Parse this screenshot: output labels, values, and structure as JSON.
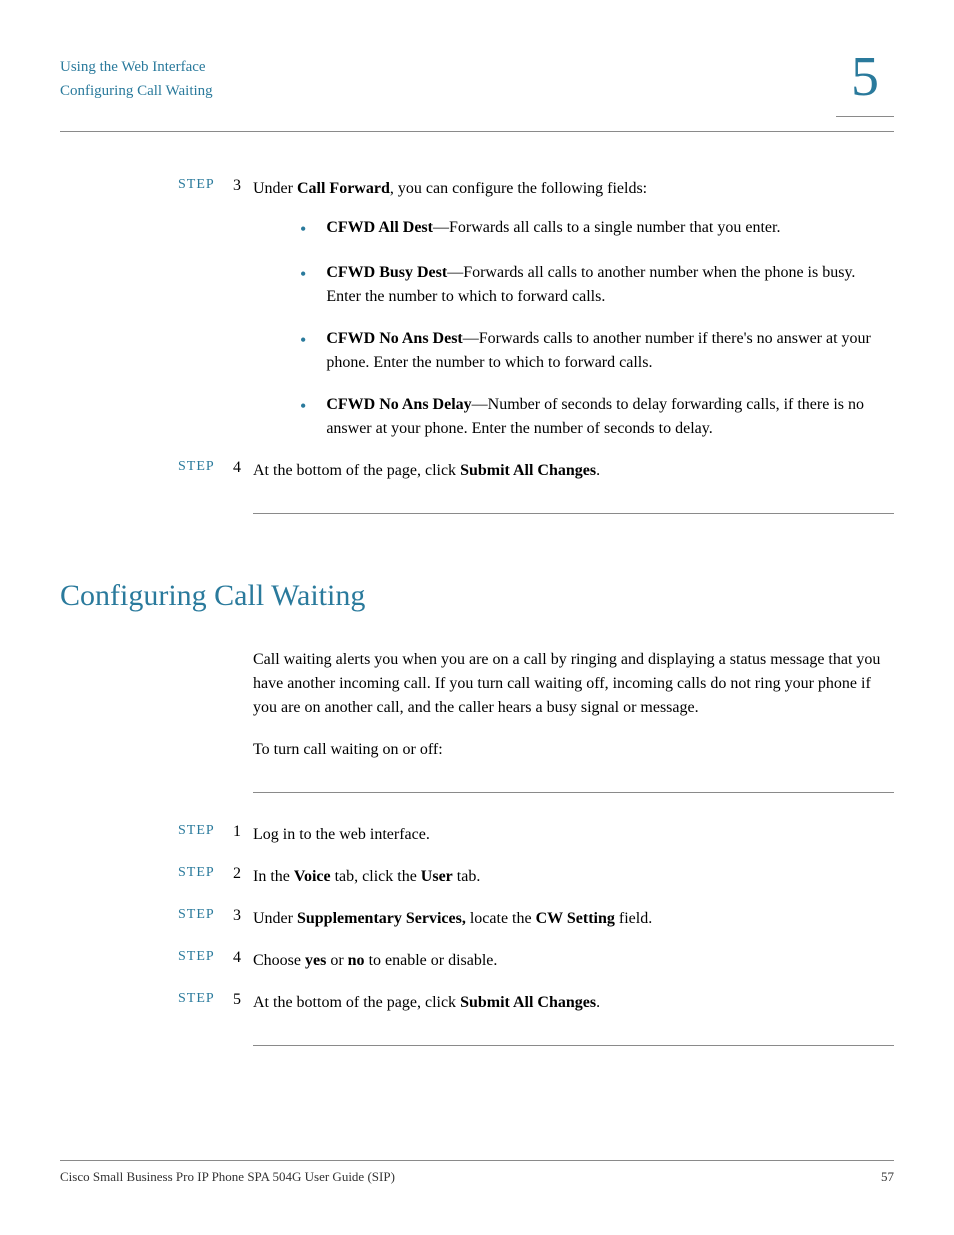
{
  "header": {
    "line1": "Using the Web Interface",
    "line2": "Configuring Call Waiting",
    "chapter": "5"
  },
  "top_steps": {
    "step3": {
      "label": "STEP",
      "num": "3",
      "intro_before_bold": "Under ",
      "intro_bold": "Call Forward",
      "intro_after_bold": ", you can configure the following fields:"
    },
    "bullets": [
      {
        "bold": "CFWD All Dest",
        "rest": "—Forwards all calls to a single number that you enter."
      },
      {
        "bold": "CFWD Busy Dest",
        "rest": "—Forwards all calls to another number when the phone is busy. Enter the number to which to forward calls."
      },
      {
        "bold": "CFWD No Ans Dest",
        "rest": "—Forwards calls to another number if there's no answer at your phone. Enter the number to which to forward calls."
      },
      {
        "bold": "CFWD No Ans Delay",
        "rest": "—Number of seconds to delay forwarding calls, if there is no answer at your phone. Enter the number of seconds to delay."
      }
    ],
    "step4": {
      "label": "STEP",
      "num": "4",
      "before_bold": "At the bottom of the page, click ",
      "bold": "Submit All Changes",
      "after_bold": "."
    }
  },
  "section": {
    "heading": "Configuring Call Waiting",
    "para1": "Call waiting alerts you when you are on a call by ringing and displaying a status message that you have another incoming call. If you turn call waiting off, incoming calls do not ring your phone if you are on another call, and the caller hears a busy signal or message.",
    "para2": "To turn call waiting on or off:"
  },
  "section_steps": [
    {
      "label": "STEP",
      "num": "1",
      "segments": [
        {
          "text": "Log in to the web interface.",
          "bold": false
        }
      ]
    },
    {
      "label": "STEP",
      "num": "2",
      "segments": [
        {
          "text": "In the ",
          "bold": false
        },
        {
          "text": "Voice",
          "bold": true
        },
        {
          "text": " tab, click the ",
          "bold": false
        },
        {
          "text": "User",
          "bold": true
        },
        {
          "text": " tab.",
          "bold": false
        }
      ]
    },
    {
      "label": "STEP",
      "num": "3",
      "segments": [
        {
          "text": "Under ",
          "bold": false
        },
        {
          "text": "Supplementary Services,",
          "bold": true
        },
        {
          "text": " locate the ",
          "bold": false
        },
        {
          "text": "CW Setting",
          "bold": true
        },
        {
          "text": " field.",
          "bold": false
        }
      ]
    },
    {
      "label": "STEP",
      "num": "4",
      "segments": [
        {
          "text": "Choose ",
          "bold": false
        },
        {
          "text": "yes",
          "bold": true
        },
        {
          "text": " or ",
          "bold": false
        },
        {
          "text": "no",
          "bold": true
        },
        {
          "text": " to enable or disable.",
          "bold": false
        }
      ]
    },
    {
      "label": "STEP",
      "num": "5",
      "segments": [
        {
          "text": "At the bottom of the page, click ",
          "bold": false
        },
        {
          "text": "Submit All Changes",
          "bold": true
        },
        {
          "text": ".",
          "bold": false
        }
      ]
    }
  ],
  "footer": {
    "left": "Cisco Small Business Pro IP Phone SPA 504G User Guide (SIP)",
    "right": "57"
  }
}
